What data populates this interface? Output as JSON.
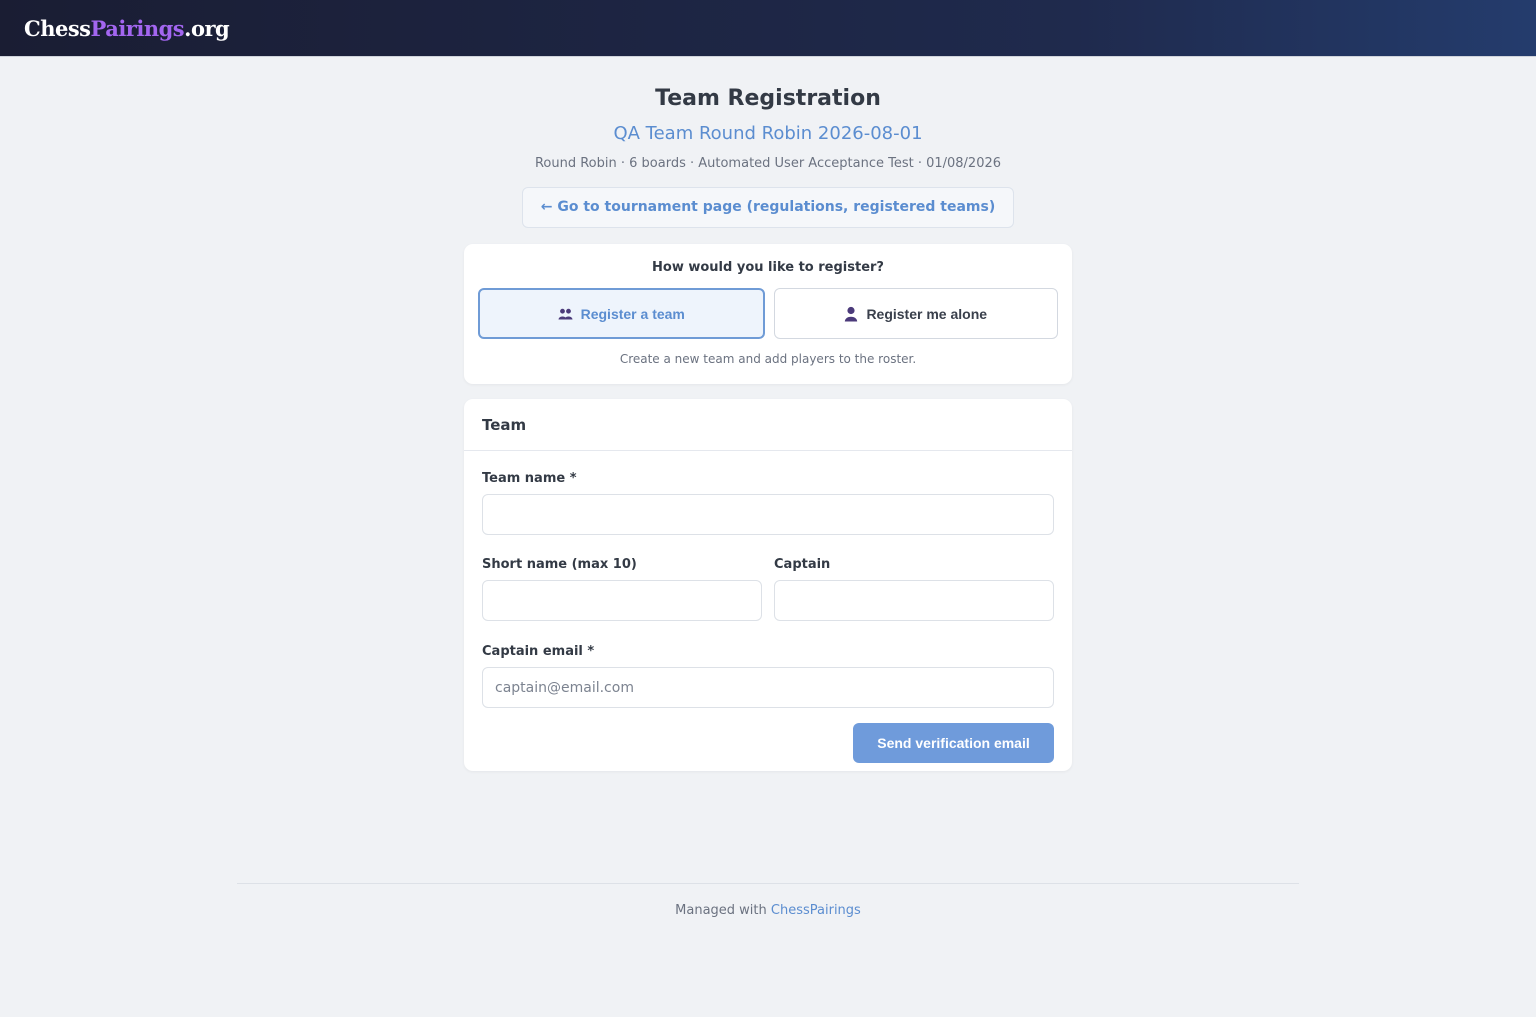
{
  "header": {
    "brand_part1": "Chess",
    "brand_part2": "Pairings",
    "brand_part3": ".org"
  },
  "page": {
    "title": "Team Registration",
    "tournament_name": "QA Team Round Robin 2026-08-01",
    "meta": "Round Robin · 6 boards · Automated User Acceptance Test · 01/08/2026",
    "back_link": "← Go to tournament page (regulations, registered teams)"
  },
  "mode": {
    "question": "How would you like to register?",
    "team_label": "Register a team",
    "team_icon": "users-icon",
    "alone_label": "Register me alone",
    "alone_icon": "user-icon",
    "hint": "Create a new team and add players to the roster.",
    "selected": "team"
  },
  "form": {
    "section_title": "Team",
    "team_name_label": "Team name *",
    "team_name_value": "",
    "short_name_label": "Short name (max 10)",
    "short_name_value": "",
    "captain_label": "Captain",
    "captain_value": "",
    "captain_email_label": "Captain email *",
    "captain_email_placeholder": "captain@email.com",
    "submit_label": "Send verification email"
  },
  "footer": {
    "text": "Managed with",
    "link": "ChessPairings"
  },
  "colors": {
    "accent": "#5b8dd0",
    "brand_accent": "#a366f0",
    "submit_bg": "#6f9bdb",
    "page_bg": "#f0f2f5"
  }
}
